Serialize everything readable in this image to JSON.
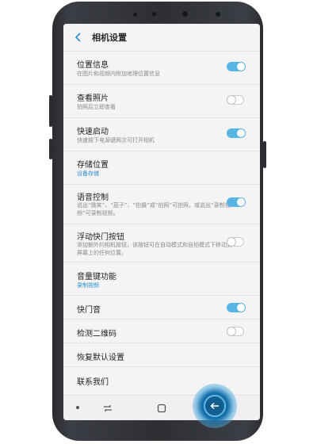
{
  "header": {
    "title": "相机设置"
  },
  "settings": [
    {
      "title": "位置信息",
      "subtitle": "在图片和视频内附加地理位置信息",
      "toggle": "on"
    },
    {
      "title": "查看照片",
      "subtitle": "拍照后立即查看",
      "toggle": "off"
    },
    {
      "title": "快速启动",
      "subtitle": "快速按下电源键两次可打开相机",
      "toggle": "on"
    },
    {
      "title": "存储位置",
      "subtitle": "设备存储",
      "toggle": "none"
    },
    {
      "title": "语音控制",
      "subtitle": "说出“微笑”、“茄子”、“拍摄”或“拍照”可拍照，或说出“录制视频”可录制视频。",
      "toggle": "on"
    },
    {
      "title": "浮动快门按钮",
      "subtitle": "添加额外的相机按钮，该按钮可在自动模式和自拍模式下移动到屏幕上的任何位置。",
      "toggle": "off"
    },
    {
      "title": "音量键功能",
      "subtitle": "录制视频",
      "toggle": "none"
    },
    {
      "title": "快门音",
      "subtitle": "",
      "toggle": "on"
    },
    {
      "title": "检测二维码",
      "subtitle": "",
      "toggle": "off"
    },
    {
      "title": "恢复默认设置",
      "subtitle": "",
      "toggle": "none"
    },
    {
      "title": "联系我们",
      "subtitle": "",
      "toggle": "none"
    }
  ],
  "colors": {
    "accent": "#58b4e3",
    "link": "#2a8ccd",
    "tap_highlight": "#1672ab"
  },
  "icons": {
    "back": "chevron-left-icon",
    "recent": "recent-apps-icon",
    "home": "home-icon",
    "nav_back": "back-arrow-icon"
  }
}
